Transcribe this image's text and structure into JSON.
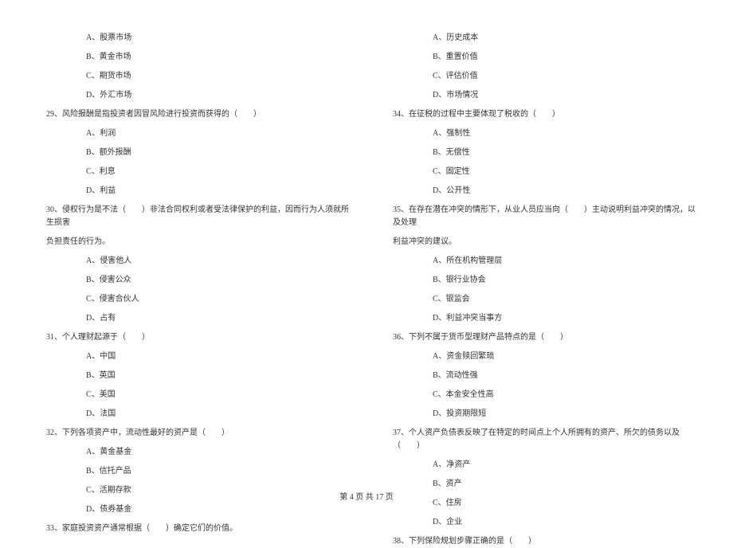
{
  "left_column": {
    "q28_options": [
      "A、股票市场",
      "B、黄金市场",
      "C、期货市场",
      "D、外汇市场"
    ],
    "q29": {
      "text": "29、风险报酬是指投资者因冒风险进行投资而获得的（　　）",
      "options": [
        "A、利润",
        "B、额外报酬",
        "C、利息",
        "D、利益"
      ]
    },
    "q30": {
      "text": "30、侵权行为是不法（　　）非法合同权利或者受法律保护的利益，因而行为人须就所生损害",
      "text_cont": "负担责任的行为。",
      "options": [
        "A、侵害他人",
        "B、侵害公众",
        "C、侵害合伙人",
        "D、占有"
      ]
    },
    "q31": {
      "text": "31、个人理财起源于（　　）",
      "options": [
        "A、中国",
        "B、英国",
        "C、美国",
        "D、法国"
      ]
    },
    "q32": {
      "text": "32、下列各项资产中，流动性最好的资产是（　　）",
      "options": [
        "A、黄金基金",
        "B、信托产品",
        "C、活期存款",
        "D、债券基金"
      ]
    },
    "q33": {
      "text": "33、家庭投资资产通常根据（　　）确定它们的价值。"
    }
  },
  "right_column": {
    "q33_options": [
      "A、历史成本",
      "B、重置价值",
      "C、评估价值",
      "D、市场情况"
    ],
    "q34": {
      "text": "34、在征税的过程中主要体现了税收的（　　）",
      "options": [
        "A、强制性",
        "B、无偿性",
        "C、固定性",
        "D、公开性"
      ]
    },
    "q35": {
      "text": "35、在存在潜在冲突的情形下，从业人员应当向（　　）主动说明利益冲突的情况，以及处理",
      "text_cont": "利益冲突的建议。",
      "options": [
        "A、所在机构管理层",
        "B、银行业协会",
        "C、银监会",
        "D、利益冲突当事方"
      ]
    },
    "q36": {
      "text": "36、下列不属于货币型理财产品特点的是（　　）",
      "options": [
        "A、资金赎回繁琐",
        "B、流动性强",
        "C、本金安全性高",
        "D、投资期限短"
      ]
    },
    "q37": {
      "text": "37、个人资产负债表反映了在特定的时间点上个人所拥有的资产、所欠的债务以及（　　）",
      "options": [
        "A、净资产",
        "B、资产",
        "C、住房",
        "D、企业"
      ]
    },
    "q38": {
      "text": "38、下列保险规划步骤正确的是（　　）"
    }
  },
  "footer": "第 4 页 共 17 页"
}
